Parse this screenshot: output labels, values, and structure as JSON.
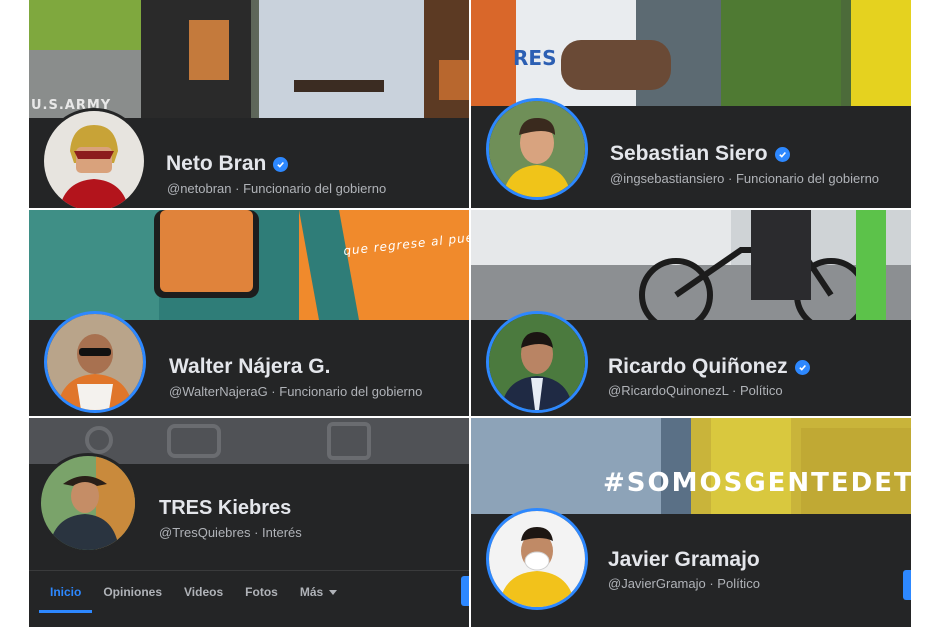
{
  "profiles": [
    {
      "name": "Neto Bran",
      "verified": true,
      "handle": "@netobran",
      "category": "Funcionario del gobierno"
    },
    {
      "name": "Sebastian Siero",
      "verified": true,
      "handle": "@ingsebastiansiero",
      "category": "Funcionario del gobierno"
    },
    {
      "name": "Walter Nájera G.",
      "verified": false,
      "handle": "@WalterNajeraG",
      "category": "Funcionario del gobierno"
    },
    {
      "name": "Ricardo Quiñonez",
      "verified": true,
      "handle": "@RicardoQuinonezL",
      "category": "Político"
    },
    {
      "name": "TRES Kiebres",
      "verified": false,
      "handle": "@TresQuiebres",
      "category": "Interés"
    },
    {
      "name": "Javier Gramajo",
      "verified": false,
      "handle": "@JavierGramajo",
      "category": "Político"
    }
  ],
  "covers": {
    "p1_text": "U.S.ARMY",
    "p2_text": "RES",
    "p3_text": "que regrese al pueblo",
    "p6_text": "#SOMOSGENTEDETR"
  },
  "tabs": {
    "inicio": "Inicio",
    "opiniones": "Opiniones",
    "videos": "Videos",
    "fotos": "Fotos",
    "mas": "Más"
  },
  "separator": " · ",
  "colors": {
    "accent": "#2d88ff",
    "panel": "#242526"
  }
}
